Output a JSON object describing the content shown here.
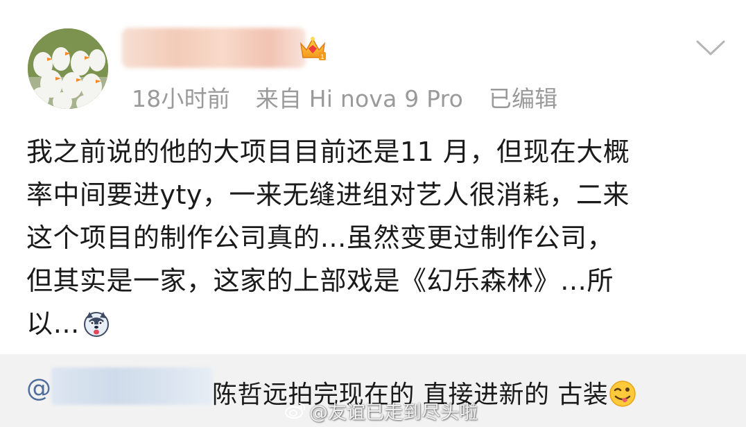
{
  "post": {
    "meta": {
      "time": "18小时前",
      "source": "来自 Hi nova 9 Pro",
      "edited": "已编辑"
    },
    "text_lines": [
      "我之前说的他的大项目目前还是11 月，但现在大概",
      "率中间要进yty，一来无缝进组对艺人很消耗，二来",
      "这个项目的制作公司真的…虽然变更过制作公司，",
      "但其实是一家，这家的上部戏是《幻乐森林》…所",
      "以…"
    ],
    "inline_emoji": "dog-emoji"
  },
  "repost": {
    "at_symbol": "@",
    "text": "陈哲远拍完现在的 直接进新的 古装",
    "emoji": "wink-tongue-emoji"
  },
  "watermark": {
    "text": "@友谊已走到尽头啦"
  },
  "colors": {
    "link_blue": "#4f6e9c",
    "meta_gray": "#9a9a9a",
    "repost_bg": "#f2f2f2"
  }
}
